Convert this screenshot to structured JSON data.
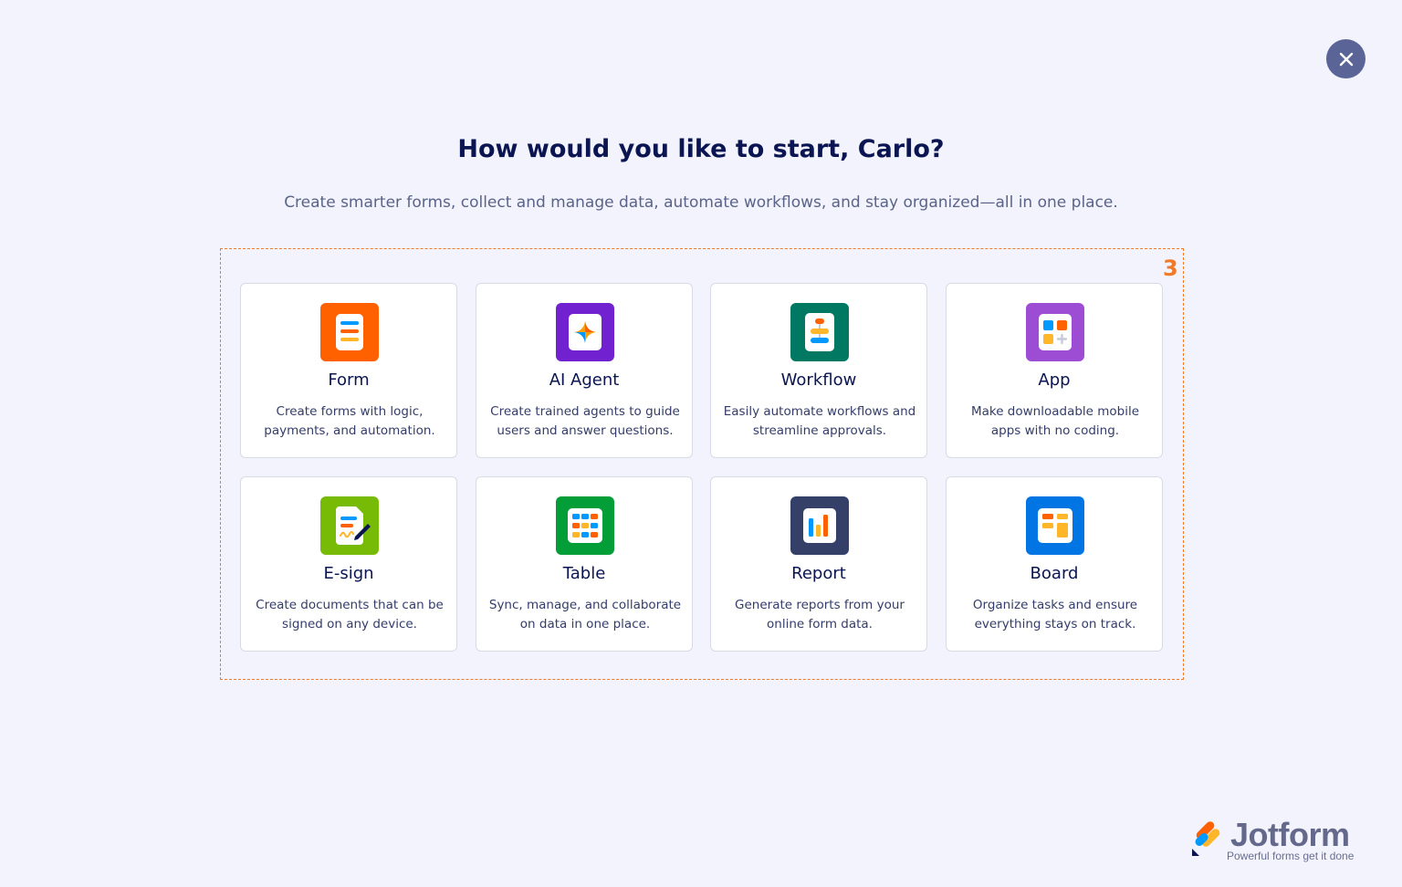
{
  "header": {
    "title": "How would you like to start, Carlo?",
    "subtitle": "Create smarter forms, collect and manage data, automate workflows, and stay organized—all in one place."
  },
  "highlight": {
    "number": "3",
    "color": "#f07a28"
  },
  "options": [
    {
      "id": "form",
      "title": "Form",
      "description": "Create forms with logic, payments, and automation.",
      "icon": "form-icon",
      "color": "#ff6100"
    },
    {
      "id": "ai-agent",
      "title": "AI Agent",
      "description": "Create trained agents to guide users and answer questions.",
      "icon": "ai-agent-icon",
      "color": "#7221d1"
    },
    {
      "id": "workflow",
      "title": "Workflow",
      "description": "Easily automate workflows and streamline approvals.",
      "icon": "workflow-icon",
      "color": "#007862"
    },
    {
      "id": "app",
      "title": "App",
      "description": "Make downloadable mobile apps with no coding.",
      "icon": "app-icon",
      "color": "#9c4dd3"
    },
    {
      "id": "e-sign",
      "title": "E-sign",
      "description": "Create documents that can be signed on any device.",
      "icon": "e-sign-icon",
      "color": "#78bb07"
    },
    {
      "id": "table",
      "title": "Table",
      "description": "Sync, manage, and collaborate on data in one place.",
      "icon": "table-icon",
      "color": "#049e38"
    },
    {
      "id": "report",
      "title": "Report",
      "description": "Generate reports from your online form data.",
      "icon": "report-icon",
      "color": "#344067"
    },
    {
      "id": "board",
      "title": "Board",
      "description": "Organize tasks and ensure everything stays on track.",
      "icon": "board-icon",
      "color": "#0075e3"
    }
  ],
  "brand": {
    "name": "Jotform",
    "tagline": "Powerful forms get it done"
  },
  "close": {
    "icon": "close-icon"
  }
}
